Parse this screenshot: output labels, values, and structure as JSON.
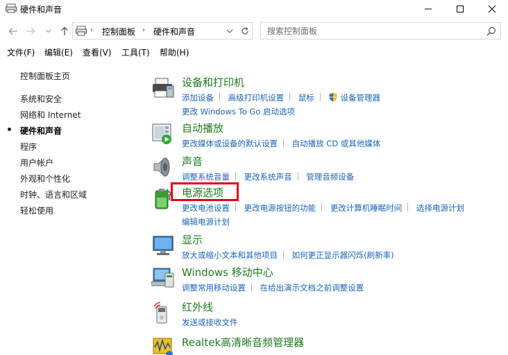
{
  "window": {
    "title": "硬件和声音"
  },
  "address": {
    "crumbs": [
      "控制面板",
      "硬件和声音"
    ],
    "search_placeholder": "搜索控制面板"
  },
  "menu": [
    "文件(F)",
    "编辑(E)",
    "查看(V)",
    "工具(T)",
    "帮助(H)"
  ],
  "sidebar": {
    "home": "控制面板主页",
    "items": [
      "系统和安全",
      "网络和 Internet",
      "硬件和声音",
      "程序",
      "用户帐户",
      "外观和个性化",
      "时钟、语言和区域",
      "轻松使用"
    ],
    "current_index": 2
  },
  "categories": [
    {
      "icon": "printer-icon",
      "title": "设备和打印机",
      "lines": [
        [
          "添加设备",
          "高级打印机设置",
          "鼠标",
          "设备管理器"
        ],
        [
          "更改 Windows To Go 启动选项"
        ]
      ]
    },
    {
      "icon": "autoplay-icon",
      "title": "自动播放",
      "lines": [
        [
          "更改媒体或设备的默认设置",
          "自动播放 CD 或其他媒体"
        ]
      ]
    },
    {
      "icon": "speaker-icon",
      "title": "声音",
      "lines": [
        [
          "调整系统音量",
          "更改系统声音",
          "管理音频设备"
        ]
      ]
    },
    {
      "icon": "power-icon",
      "title": "电源选项",
      "lines": [
        [
          "更改电池设置",
          "更改电源按钮的功能",
          "更改计算机睡眠时间",
          "选择电源计划"
        ],
        [
          "编辑电源计划"
        ]
      ]
    },
    {
      "icon": "display-icon",
      "title": "显示",
      "lines": [
        [
          "放大或缩小文本和其他项目",
          "如何更正显示器闪烁(刷新率)"
        ]
      ]
    },
    {
      "icon": "mobility-center-icon",
      "title": "Windows 移动中心",
      "lines": [
        [
          "调整常用移动设置",
          "在给出演示文档之前调整设置"
        ]
      ]
    },
    {
      "icon": "infrared-icon",
      "title": "红外线",
      "lines": [
        [
          "发送或接收文件"
        ]
      ]
    },
    {
      "icon": "realtek-audio-icon",
      "title": "Realtek高清晰音频管理器",
      "lines": []
    }
  ],
  "colors": {
    "heading": "#1e7a1e",
    "link": "#1c63b7",
    "highlight": "#e60012"
  }
}
